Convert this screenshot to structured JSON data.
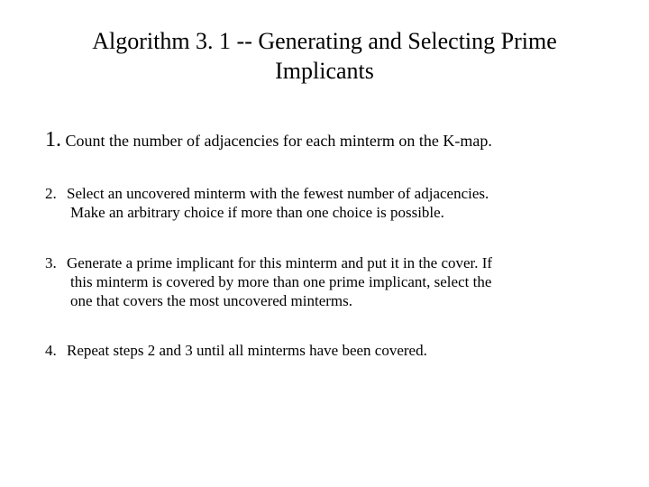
{
  "title_line": "Algorithm 3. 1 -- Generating and Selecting Prime Implicants",
  "items": [
    {
      "num": "1.",
      "text": "Count the number of adjacencies for each minterm on the K-map."
    },
    {
      "num": "2.",
      "line1": "Select an uncovered minterm with the fewest number of adjacencies.",
      "line2": "Make an arbitrary choice if more than one choice is possible."
    },
    {
      "num": "3.",
      "line1": "Generate a prime implicant for this minterm and put it in the cover.  If",
      "line2": "this minterm is covered by more than one prime implicant, select the",
      "line3": "one that covers the most uncovered minterms."
    },
    {
      "num": "4.",
      "text": "Repeat steps 2 and 3 until all minterms have been covered."
    }
  ]
}
